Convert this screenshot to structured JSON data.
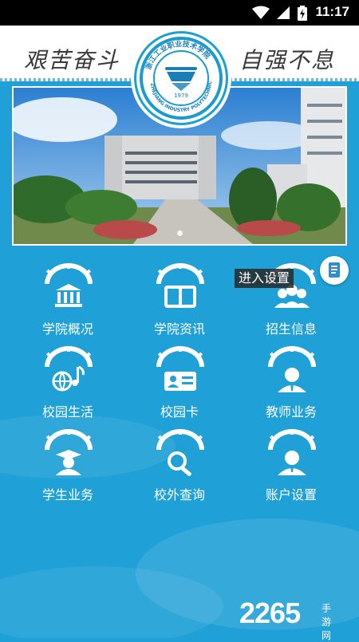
{
  "status_bar": {
    "time": "11:17"
  },
  "header": {
    "slogan_left": "艰苦奋斗",
    "slogan_right": "自强不息",
    "emblem_year": "1979",
    "emblem_arc_text": "ZHEJIANG INDUSTRY POLYTECHNIC COLLEGE"
  },
  "carousel": {
    "page_count": 1,
    "current_page": 1
  },
  "menu": [
    {
      "label": "学院概况",
      "icon": "building-icon"
    },
    {
      "label": "学院资讯",
      "icon": "open-book-icon"
    },
    {
      "label": "招生信息",
      "icon": "people-group-icon"
    },
    {
      "label": "校园生活",
      "icon": "ball-music-icon"
    },
    {
      "label": "校园卡",
      "icon": "id-card-icon"
    },
    {
      "label": "教师业务",
      "icon": "teacher-icon"
    },
    {
      "label": "学生业务",
      "icon": "graduate-icon"
    },
    {
      "label": "校外查询",
      "icon": "magnifier-icon"
    },
    {
      "label": "账户设置",
      "icon": "user-settings-icon"
    }
  ],
  "floating_button": {
    "tooltip": "进入设置",
    "icon": "document-icon"
  },
  "watermark": {
    "brand": "2265",
    "site": "手游网"
  },
  "colors": {
    "background": "#1fa0d6",
    "emblem_ring": "#1aa1d4",
    "status_bar": "#000000"
  }
}
